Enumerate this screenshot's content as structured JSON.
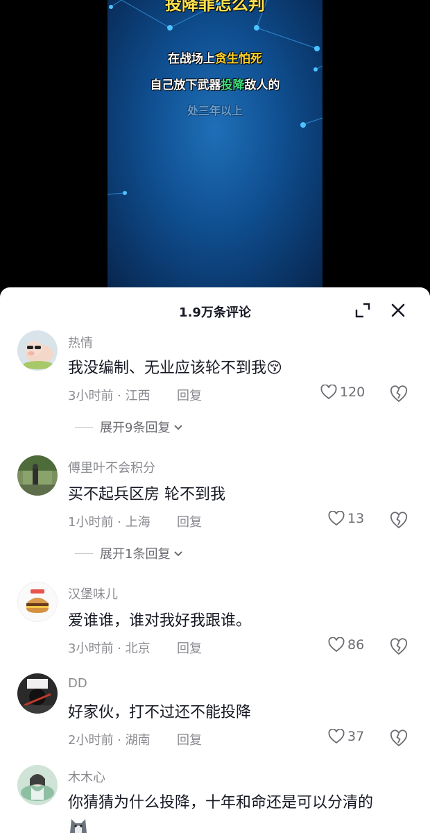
{
  "video": {
    "caption_top": "投降罪怎么判",
    "caption_line1_pre": "在战场上",
    "caption_line1_hl": "贪生怕死",
    "caption_line2_pre": "自己放下武器",
    "caption_line2_hl": "投降",
    "caption_line2_post": "敌人的",
    "caption_line3": "处三年以上"
  },
  "panel": {
    "title": "1.9万条评论"
  },
  "comments": [
    {
      "author": "热情",
      "text": "我没编制、无业应该轮不到我",
      "emoji": "😚",
      "meta": "3小时前 · 江西",
      "reply": "回复",
      "likes": "120",
      "expand": "展开9条回复"
    },
    {
      "author": "傅里叶不会积分",
      "text": "买不起兵区房 轮不到我",
      "meta": "1小时前 · 上海",
      "reply": "回复",
      "likes": "13",
      "expand": "展开1条回复"
    },
    {
      "author": "汉堡味儿",
      "text": "爱谁谁，谁对我好我跟谁。",
      "meta": "3小时前 · 北京",
      "reply": "回复",
      "likes": "86"
    },
    {
      "author": "DD",
      "text": "好家伙，打不过还不能投降",
      "meta": "2小时前 · 湖南",
      "reply": "回复",
      "likes": "37"
    },
    {
      "author": "木木心",
      "text": "你猜猜为什么投降，十年和命还是可以分清的"
    }
  ],
  "colors": {
    "accent_yellow": "#ffd42a",
    "accent_green": "#3fe07a",
    "meta_gray": "#8a8b91",
    "text_dark": "#161823"
  }
}
